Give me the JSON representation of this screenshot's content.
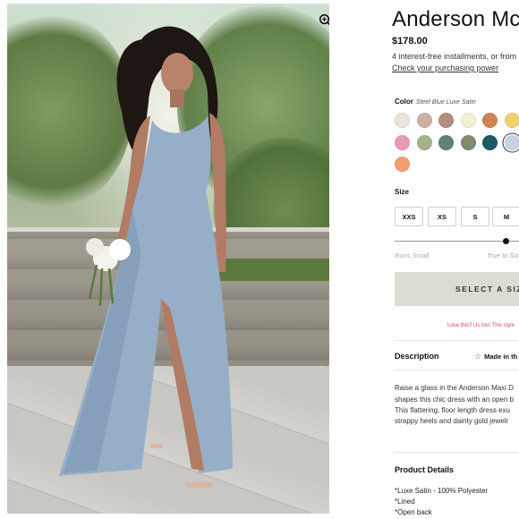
{
  "product": {
    "title": "Anderson Mc",
    "price": "$178.00",
    "installments": "4 interest-free installments, or from",
    "purchasing_power_link": "Check your purchasing power"
  },
  "colors": {
    "label": "Color",
    "selected_name": "Steel Blue Luxe Satin",
    "swatches": [
      "#ede3d8",
      "#cdb0a2",
      "#b58e7e",
      "#f3f0d4",
      "#cf8450",
      "#f0d16d",
      "#e69ab8",
      "#a6b28a",
      "#5f8272",
      "#7f8b6e",
      "#1e5967",
      "#c6d2e3",
      "#eea070"
    ],
    "selected_index": 11
  },
  "sizes": {
    "label": "Size",
    "options": [
      "XXS",
      "XS",
      "S",
      "M"
    ]
  },
  "fit": {
    "left": "Runs Small",
    "right": "True to Siz",
    "value": 0.88
  },
  "cta": {
    "select_size": "SELECT A SIZE",
    "love": "Love this? Us too! This style"
  },
  "description": {
    "heading": "Description",
    "made_in": "Made in th",
    "lines": [
      "Raise a glass in the Anderson Maxi D",
      "shapes this chic dress with an open b",
      "This flattering, floor length dress exu",
      "strappy heels and dainty gold jewelr"
    ]
  },
  "details": {
    "heading": "Product Details",
    "items": [
      "*Luxe Satin - 100% Polyester",
      "*Lined",
      "*Open back"
    ]
  },
  "icons": {
    "zoom": "zoom-in-icon",
    "made_in": "star-icon"
  }
}
